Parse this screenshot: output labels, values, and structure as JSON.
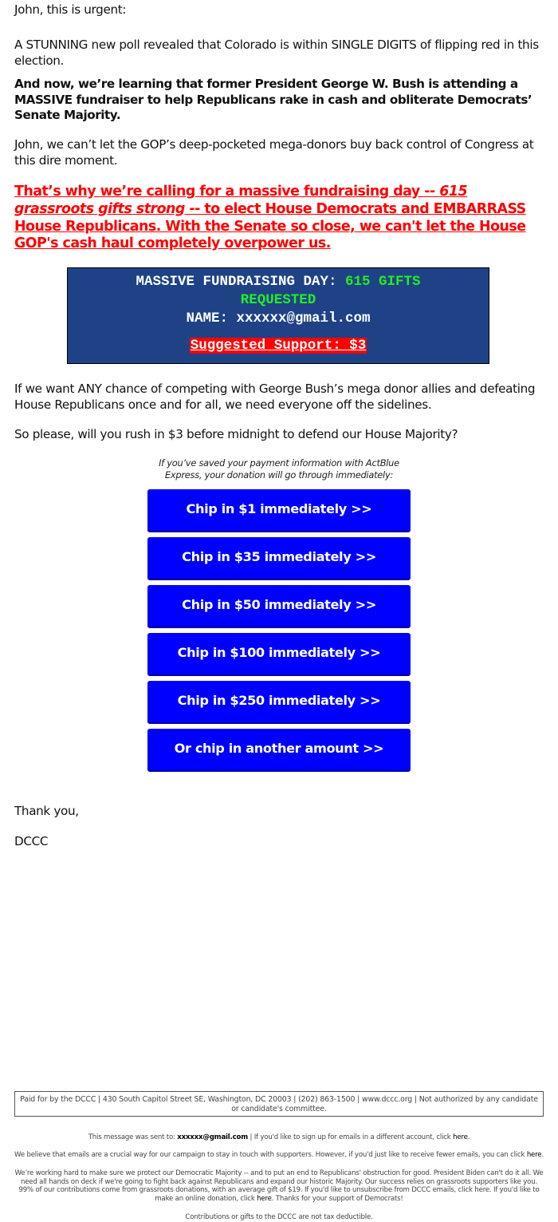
{
  "email": {
    "greeting": "John, this is urgent:",
    "poll_paragraph": "A STUNNING new poll revealed that Colorado is within SINGLE DIGITS of flipping red in this election.",
    "bush_paragraph": "And now, we’re learning that former President George W. Bush is attending a MASSIVE fundraiser to help Republicans rake in cash and obliterate Democrats’ Senate Majority.",
    "gop_paragraph": "John, we can’t let the GOP’s deep-pocketed mega-donors buy back control of Congress at this dire moment.",
    "red_callout": {
      "part1": "That’s why we’re calling for a massive fundraising day -- ",
      "italic": "615 grassroots gifts strong",
      "part2": " -- to elect House Democrats and EMBARRASS House Republicans. With the Senate so close, we can't let the House GOP's cash haul completely overpower us."
    },
    "banner": {
      "title": "MASSIVE FUNDRAISING DAY:",
      "gifts": "615 GIFTS REQUESTED",
      "gifts_line1": "615 GIFTS",
      "gifts_line2": "REQUESTED",
      "name_label": "NAME:",
      "name_value": "xxxxxx@gmail.com",
      "support": "Suggested Support: $3"
    },
    "chance_paragraph": "If we want ANY chance of competing with George Bush’s mega donor allies and defeating House Republicans once and for all, we need everyone off the sidelines.",
    "please_paragraph": "So please, will you rush in $3 before midnight to defend our House Majority?",
    "actblue_note": "If you’ve saved your payment information with ActBlue Express, your donation will go through immediately:",
    "buttons": [
      {
        "label": "Chip in $1 immediately >>"
      },
      {
        "label": "Chip in $35 immediately >>"
      },
      {
        "label": "Chip in $50 immediately >>"
      },
      {
        "label": "Chip in $100 immediately >>"
      },
      {
        "label": "Chip in $250 immediately >>"
      },
      {
        "label": "Or chip in another amount >>"
      }
    ],
    "signoff": "Thank you,",
    "signature": "DCCC"
  },
  "footer": {
    "paid_for": "Paid for by the DCCC | 430 South Capitol Street SE, Washington, DC 20003 | (202) 863-1500 | www.dccc.org | Not authorized by any candidate or candidate's committee.",
    "sent_to_prefix": "This message was sent to:",
    "sent_to_email": "xxxxxx@gmail.com",
    "sent_to_suffix": " | If you'd like to sign up for emails in a different account, click ",
    "here": "here",
    "fewer_emails": "We believe that emails are a crucial way for our campaign to stay in touch with supporters. However, if you'd just like to receive fewer emails, you can click ",
    "working_hard": "We’re working hard to make sure we protect our Democratic Majority -- and to put an end to Republicans' obstruction for good. President Biden can't do it all. We need all hands on deck if we're going to fight back against Republicans and expand our historic Majority. Our success relies on grassroots supporters like you. 99% of our contributions come from grassroots donations, with an average gift of $19. If you'd like to unsubscribe from DCCC emails, click here. If you'd like to make an online donation, click ",
    "working_hard_end": ". Thanks for your support of Democrats!",
    "tax_note": "Contributions or gifts to the DCCC are not tax deductible."
  },
  "colors": {
    "callout_red": "#ff0000",
    "banner_blue": "#1f4286",
    "banner_green": "#22ee22",
    "button_blue": "#0000ff",
    "button_edge": "#0000c0"
  }
}
